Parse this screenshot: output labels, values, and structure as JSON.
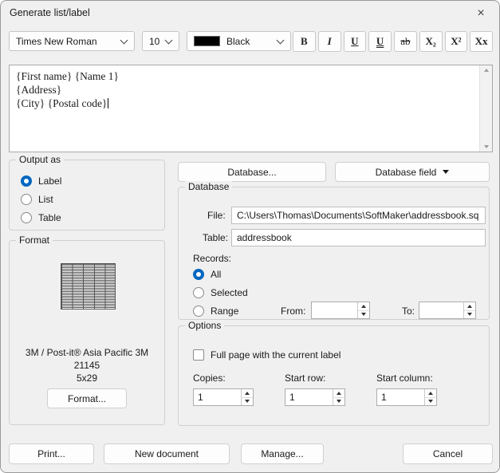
{
  "window": {
    "title": "Generate list/label",
    "close_icon": "×"
  },
  "toolbar": {
    "font": "Times New Roman",
    "size": "10",
    "color": "Black",
    "format_buttons": [
      "B",
      "I",
      "U",
      "U",
      "ab",
      "X₂",
      "X²",
      "Xx"
    ]
  },
  "editor": {
    "lines": [
      "{First name} {Name 1}",
      "{Address}",
      "{City} {Postal code}"
    ]
  },
  "output_as": {
    "title": "Output as",
    "options": [
      {
        "label": "Label",
        "selected": true
      },
      {
        "label": "List",
        "selected": false
      },
      {
        "label": "Table",
        "selected": false
      }
    ]
  },
  "format": {
    "title": "Format",
    "line1": "3M / Post-it®  Asia Pacific 3M",
    "line2": "21145",
    "line3": "5x29",
    "button": "Format..."
  },
  "actions": {
    "database": "Database...",
    "database_field": "Database field"
  },
  "database": {
    "title": "Database",
    "file_label": "File:",
    "file_value": "C:\\Users\\Thomas\\Documents\\SoftMaker\\addressbook.sq",
    "table_label": "Table:",
    "table_value": "addressbook",
    "records_label": "Records:",
    "records": [
      {
        "label": "All",
        "selected": true
      },
      {
        "label": "Selected",
        "selected": false
      },
      {
        "label": "Range",
        "selected": false
      }
    ],
    "from_label": "From:",
    "from_value": "",
    "to_label": "To:",
    "to_value": ""
  },
  "options": {
    "title": "Options",
    "full_page_label": "Full page with the current label",
    "full_page_checked": false,
    "copies_label": "Copies:",
    "copies_value": "1",
    "start_row_label": "Start row:",
    "start_row_value": "1",
    "start_column_label": "Start column:",
    "start_column_value": "1"
  },
  "footer": {
    "print": "Print...",
    "new_document": "New document",
    "manage": "Manage...",
    "cancel": "Cancel"
  },
  "colors": {
    "accent": "#0067c0",
    "color_swatch": "#000000"
  }
}
